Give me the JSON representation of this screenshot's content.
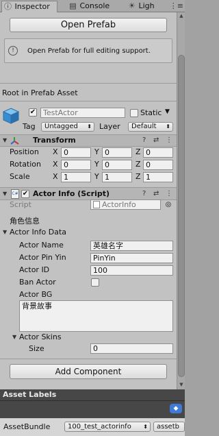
{
  "tabs": [
    {
      "label": "Inspector",
      "icon": "info-icon",
      "active": true
    },
    {
      "label": "Console",
      "icon": "console-icon",
      "active": false
    },
    {
      "label": "Ligh",
      "icon": "light-icon",
      "active": false
    }
  ],
  "tab_menu_glyph": "⋮≡",
  "inspector": {
    "open_prefab_button": "Open Prefab",
    "help_box_text": "Open Prefab for full editing support.",
    "root_label": "Root in Prefab Asset",
    "gameobject": {
      "name": "TestActor",
      "active": true,
      "static_label": "Static",
      "tag_label": "Tag",
      "tag_value": "Untagged",
      "layer_label": "Layer",
      "layer_value": "Default"
    },
    "transform": {
      "title": "Transform",
      "rows": [
        {
          "label": "Position",
          "x": "0",
          "y": "0",
          "z": "0"
        },
        {
          "label": "Rotation",
          "x": "0",
          "y": "0",
          "z": "0"
        },
        {
          "label": "Scale",
          "x": "1",
          "y": "1",
          "z": "1"
        }
      ],
      "axis_x": "X",
      "axis_y": "Y",
      "axis_z": "Z"
    },
    "actor_info": {
      "title": "Actor Info (Script)",
      "script_label": "Script",
      "script_value": "ActorInfo",
      "header_label": "角色信息",
      "data_foldout": "Actor Info Data",
      "fields": [
        {
          "label": "Actor Name",
          "value": "英雄名字"
        },
        {
          "label": "Actor Pin Yin",
          "value": "PinYin"
        },
        {
          "label": "Actor ID",
          "value": "100"
        }
      ],
      "ban_actor_label": "Ban Actor",
      "ban_actor_checked": false,
      "bg_label": "Actor BG",
      "bg_value": "背景故事",
      "skins_foldout": "Actor Skins",
      "size_label": "Size",
      "size_value": "0"
    },
    "add_component_button": "Add Component"
  },
  "asset_labels": {
    "title": "Asset Labels",
    "assetbundle_label": "AssetBundle",
    "assetbundle_value": "100_test_actorinfo",
    "variant_value": "assetb"
  }
}
